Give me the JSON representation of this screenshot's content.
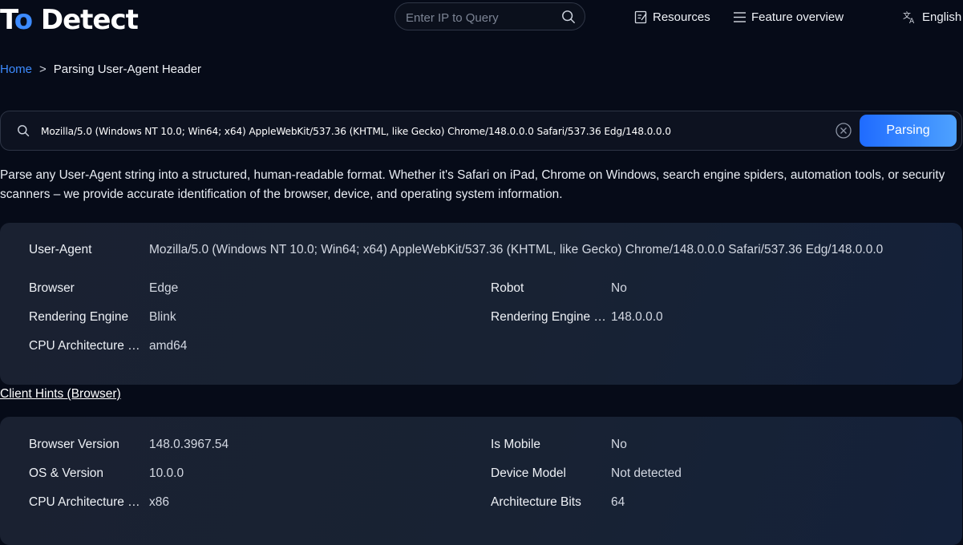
{
  "header": {
    "logo": {
      "part1": "T",
      "dot": "o",
      "part2": " Detect"
    },
    "ip_search": {
      "placeholder": "Enter IP to Query"
    },
    "nav": {
      "resources": "Resources",
      "feature_overview": "Feature overview",
      "language": "English"
    }
  },
  "breadcrumb": {
    "home": "Home",
    "separator": ">",
    "current": "Parsing User-Agent Header"
  },
  "ua_search": {
    "value": "Mozilla/5.0 (Windows NT 10.0; Win64; x64) AppleWebKit/537.36 (KHTML, like Gecko) Chrome/148.0.0.0 Safari/537.36 Edg/148.0.0.0",
    "button_label": "Parsing"
  },
  "description": "Parse any User-Agent string into a structured, human-readable format. Whether it's Safari on iPad, Chrome on Windows, search engine spiders, automation tools, or security scanners – we provide accurate identification of the browser, device, and operating system information.",
  "ua_result": {
    "user_agent": {
      "label": "User-Agent",
      "value": "Mozilla/5.0 (Windows NT 10.0; Win64; x64) AppleWebKit/537.36 (KHTML, like Gecko) Chrome/148.0.0.0 Safari/537.36 Edg/148.0.0.0"
    },
    "browser": {
      "label": "Browser",
      "value": "Edge"
    },
    "robot": {
      "label": "Robot",
      "value": "No"
    },
    "rendering_engine": {
      "label": "Rendering Engine",
      "value": "Blink"
    },
    "rendering_engine_version": {
      "label": "Rendering Engine …",
      "value": "148.0.0.0"
    },
    "cpu_architecture": {
      "label": "CPU Architecture …",
      "value": "amd64"
    }
  },
  "client_hints_link": "Client Hints (Browser)",
  "client_hints": {
    "browser_version": {
      "label": "Browser Version",
      "value": "148.0.3967.54"
    },
    "is_mobile": {
      "label": "Is Mobile",
      "value": "No"
    },
    "os_version": {
      "label": "OS & Version",
      "value": "10.0.0"
    },
    "device_model": {
      "label": "Device Model",
      "value": "Not detected"
    },
    "cpu_architecture": {
      "label": "CPU Architecture …",
      "value": "x86"
    },
    "architecture_bits": {
      "label": "Architecture Bits",
      "value": "64"
    }
  },
  "colors": {
    "background": "#060b18",
    "accent": "#3d8bff",
    "button_gradient_start": "#1f6bff",
    "button_gradient_end": "#4ea2ff",
    "card": "#1a2131"
  },
  "icons": {
    "search": "search-icon",
    "resources": "document-edit-icon",
    "feature_overview": "menu-icon",
    "language": "translate-icon",
    "clear": "clear-circle-icon"
  }
}
